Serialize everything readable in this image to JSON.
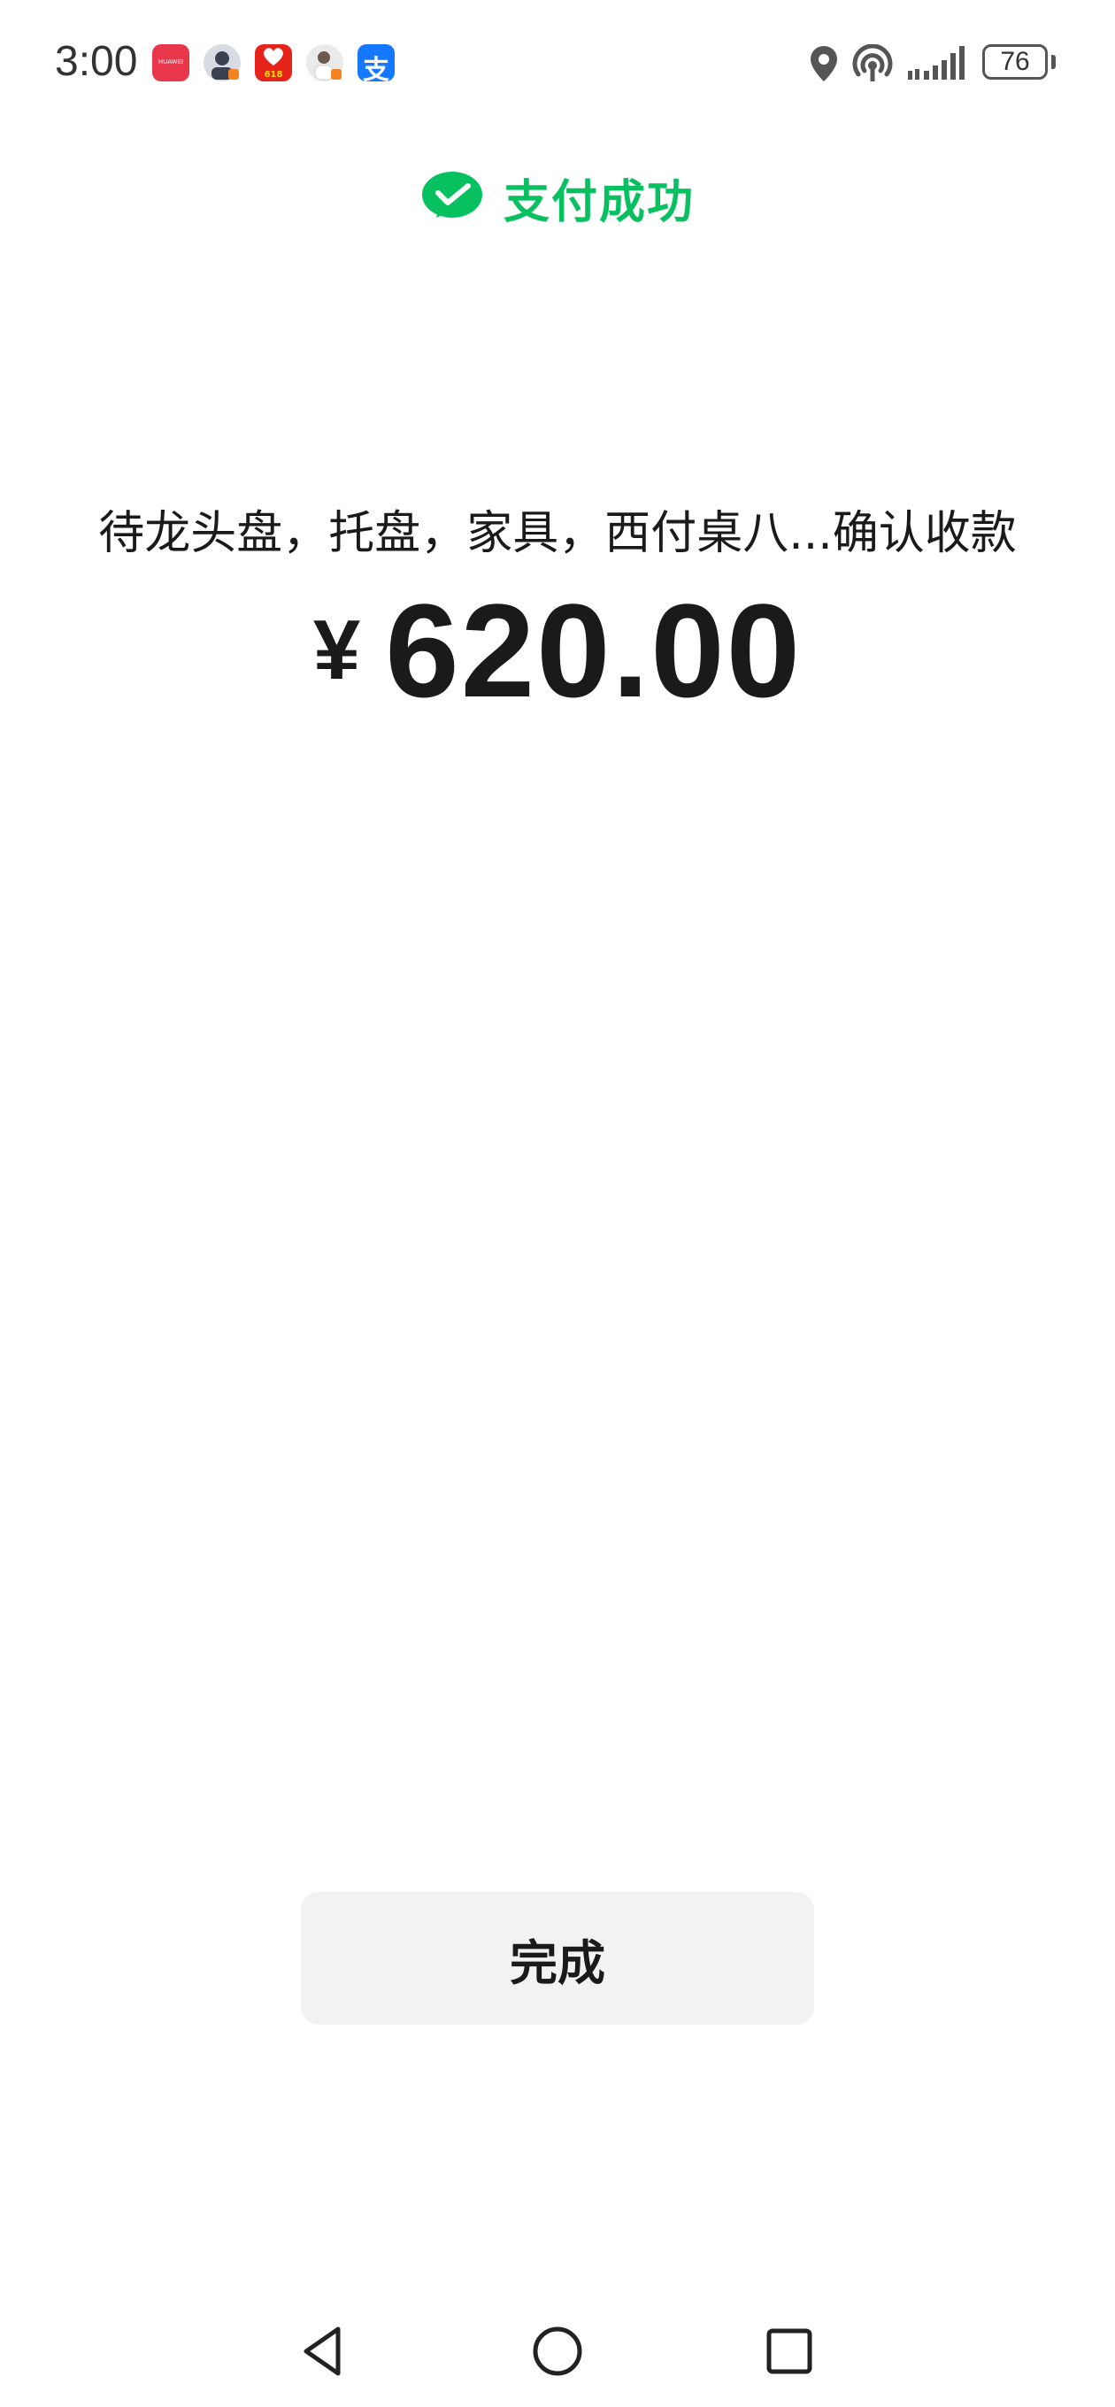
{
  "status_bar": {
    "time": "3:00",
    "battery": "76",
    "apps": [
      {
        "name": "huawei-appgallery-icon",
        "label": "HUAWEI"
      },
      {
        "name": "avatar-app-icon"
      },
      {
        "name": "shopping-618-icon",
        "label": "618"
      },
      {
        "name": "avatar-app-icon-2"
      },
      {
        "name": "alipay-icon",
        "label": "支"
      }
    ]
  },
  "header": {
    "title": "支付成功",
    "icon": "wechat-pay-icon",
    "accent_color": "#07c160"
  },
  "payment": {
    "payee": "待龙头盘，托盘，家具，西付桌八...确认收款",
    "currency_symbol": "¥",
    "amount": "620.00"
  },
  "actions": {
    "done_label": "完成"
  },
  "nav": {
    "back": "back-icon",
    "home": "home-icon",
    "recent": "recent-apps-icon"
  }
}
